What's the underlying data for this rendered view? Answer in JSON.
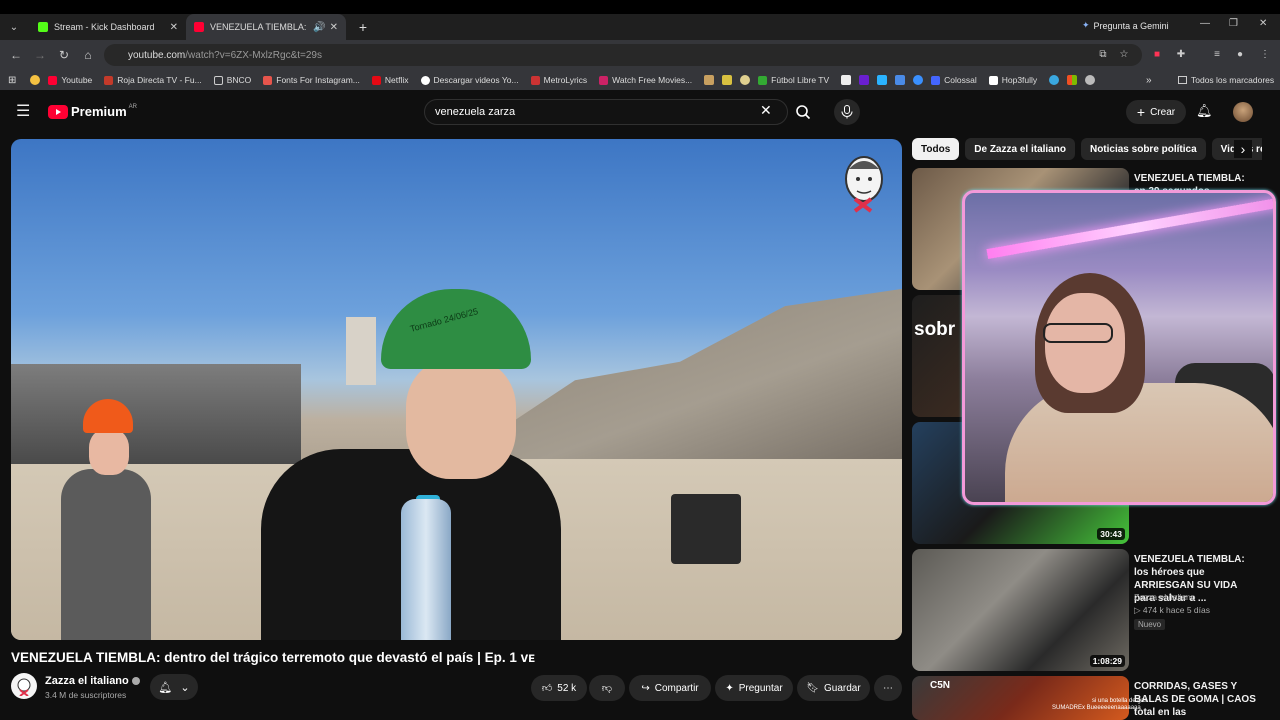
{
  "browser": {
    "tabs": [
      {
        "title": "Stream - Kick Dashboard",
        "favicon_color": "#53fc18"
      },
      {
        "title": "VENEZUELA TIEMBLA: dentro",
        "favicon_color": "#ff0033"
      }
    ],
    "gemini_label": "Pregunta a Gemini",
    "url_main": "youtube.com",
    "url_path": "/watch?v=6ZX-MxlzRgc&t=29s",
    "bookmarks": [
      {
        "label": "Youtube",
        "color": "#ff0033"
      },
      {
        "label": "Roja Directa TV - Fu...",
        "color": "#c43a2a"
      },
      {
        "label": "BNCO",
        "color": "#888888"
      },
      {
        "label": "Fonts For Instagram...",
        "color": "#e7554c"
      },
      {
        "label": "Netflix",
        "color": "#e50914"
      },
      {
        "label": "Descargar videos Yo...",
        "color": "#ffffff"
      },
      {
        "label": "MetroLyrics",
        "color": "#cc3333"
      },
      {
        "label": "Watch Free Movies...",
        "color": "#cc2266"
      },
      {
        "label": "Fútbol Libre TV",
        "color": "#33aa33"
      },
      {
        "label": "Colossal",
        "color": "#4466ff"
      },
      {
        "label": "Hop3fully",
        "color": "#ffffff"
      }
    ],
    "all_bookmarks_label": "Todos los marcadores"
  },
  "youtube": {
    "logo_text": "Premium",
    "logo_region": "AR",
    "search_query": "venezuela zarza",
    "create_label": "Crear",
    "video": {
      "title": "VENEZUELA TIEMBLA: dentro del trágico terremoto que devastó el país | Ep. 1 ᴠᴇ",
      "channel": "Zazza el italiano",
      "subscribers": "3.4 M de suscriptores",
      "likes": "52 k",
      "share_label": "Compartir",
      "ask_label": "Preguntar",
      "save_label": "Guardar",
      "helmet_text": "Tornado 24/06/25"
    },
    "chips": [
      "Todos",
      "De Zazza el italiano",
      "Noticias sobre política",
      "Videos re"
    ],
    "recommendations": [
      {
        "title": "VENEZUELA TIEMBLA: en 39 segundos PERDIERON",
        "duration": ""
      },
      {
        "title": "",
        "duration": ""
      },
      {
        "title": "",
        "duration": "30:43"
      },
      {
        "title": "VENEZUELA TIEMBLA: los héroes que ARRIESGAN SU VIDA para salvar a ...",
        "channel": "Zazza el italiano",
        "meta": "▷ 474 k   hace 5 días",
        "badge": "Nuevo",
        "duration": "1:08:29"
      },
      {
        "title": "CORRIDAS, GASES Y BALAS DE GOMA | CAOS total en las",
        "duration": ""
      }
    ],
    "overlay_chat": [
      "si una botella de gas",
      "SUMADREx Bueeeeeenaaaaaaa"
    ]
  }
}
